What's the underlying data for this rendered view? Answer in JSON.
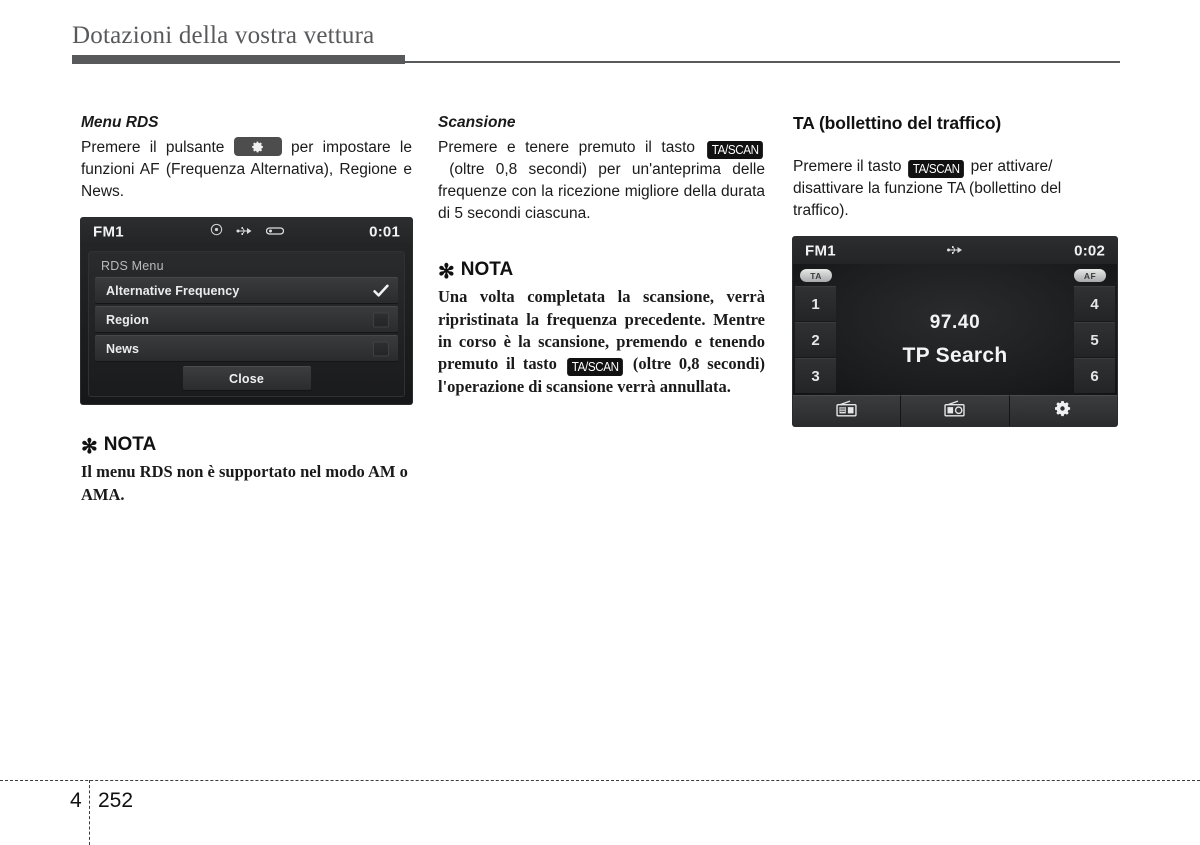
{
  "header": {
    "title": "Dotazioni della vostra vettura"
  },
  "footer": {
    "chapter": "4",
    "page": "252"
  },
  "left_column": {
    "subhead": "Menu RDS",
    "paragraph_part1": "Premere il pulsante",
    "gear_button_icon": "gear-icon",
    "paragraph_part2": "per impostare le funzioni AF (Frequenza Alternativa), Regione e News.",
    "note": {
      "star": "✻",
      "heading": "NOTA",
      "body": "Il menu RDS non è supportato nel modo AM o AMA."
    },
    "screen": {
      "source": "FM1",
      "clock": "0:01",
      "status_icons": [
        "disc-icon",
        "usb-icon",
        "aux-icon"
      ],
      "dialog_title": "RDS Menu",
      "rows": [
        {
          "label": "Alternative Frequency",
          "checked": true
        },
        {
          "label": "Region",
          "checked": false
        },
        {
          "label": "News",
          "checked": false
        }
      ],
      "close_label": "Close"
    }
  },
  "mid_column": {
    "subhead": "Scansione",
    "paragraph_part1": "Premere e tenere premuto il tasto",
    "key_label": "TA/SCAN",
    "paragraph_part2": "(oltre 0,8 secondi) per un'anteprima delle frequenze con la ricezione migliore della durata di 5 secondi ciascuna.",
    "note": {
      "star": "✻",
      "heading": "NOTA",
      "body_part1": "Una volta completata la scansione, verrà ripristinata la frequenza precedente. Mentre in corso è la scansione, premendo e tenendo premuto il tasto",
      "key_label": "TA/SCAN",
      "body_part2": "(oltre 0,8 secondi) l'operazione di scansione verrà annullata."
    }
  },
  "right_column": {
    "heading": "TA (bollettino del traffico)",
    "paragraph_part1": "Premere il tasto",
    "key_label": "TA/SCAN",
    "paragraph_part2": "per attivare/ disattivare la funzione TA (bollettino del traffico).",
    "screen": {
      "source": "FM1",
      "clock": "0:02",
      "status_icons": [
        "usb-icon"
      ],
      "badge_ta": "TA",
      "badge_af": "AF",
      "presets_left": [
        "1",
        "2",
        "3"
      ],
      "presets_right": [
        "4",
        "5",
        "6"
      ],
      "frequency": "97.40",
      "status_text": "TP Search",
      "toolbar_icons": [
        "radio-list-icon",
        "radio-scan-icon",
        "gear-icon"
      ]
    }
  },
  "colors": {
    "header_gray": "#58595b",
    "key_black": "#111111",
    "screen_dark": "#1d1e20"
  }
}
